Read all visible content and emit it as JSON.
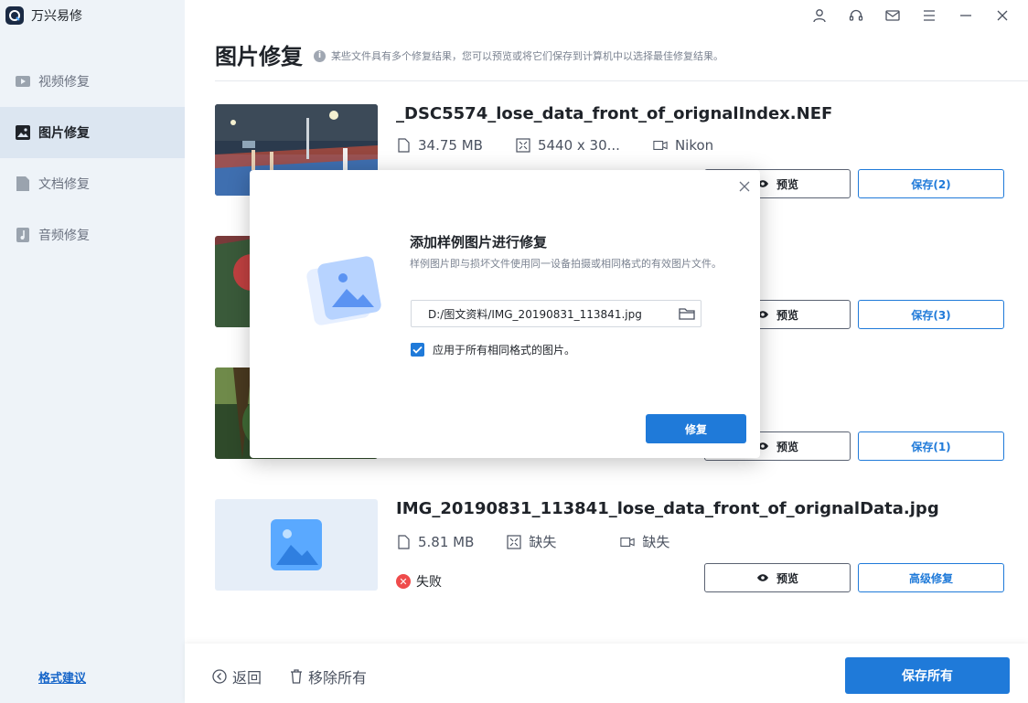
{
  "app": {
    "title": "万兴易修",
    "logo_icon": "app-logo-icon"
  },
  "titlebar": {
    "icons": [
      "user-icon",
      "headset-icon",
      "mail-icon",
      "menu-icon",
      "minimize-icon",
      "close-icon"
    ]
  },
  "sidebar": {
    "items": [
      {
        "label": "视频修复",
        "icon": "video-icon",
        "active": false
      },
      {
        "label": "图片修复",
        "icon": "image-icon",
        "active": true
      },
      {
        "label": "文档修复",
        "icon": "document-icon",
        "active": false
      },
      {
        "label": "音频修复",
        "icon": "music-icon",
        "active": false
      }
    ],
    "footer_link": "格式建议"
  },
  "main": {
    "title": "图片修复",
    "hint": "某些文件具有多个修复结果，您可以预览或将它们保存到计算机中以选择最佳修复结果。",
    "hint_icon": "info-icon",
    "items": [
      {
        "name": "_DSC5574_lose_data_front_of_orignalIndex.NEF",
        "size": "34.75  MB",
        "resolution": "5440 x 30...",
        "camera": "Nikon",
        "preview_label": "预览",
        "save_label": "保存(2)"
      },
      {
        "name": "",
        "preview_label": "预览",
        "save_label": "保存(3)"
      },
      {
        "name": "",
        "preview_label": "预览",
        "save_label": "保存(1)"
      },
      {
        "name": "IMG_20190831_113841_lose_data_front_of_orignalData.jpg",
        "size": "5.81  MB",
        "resolution": "缺失",
        "camera": "缺失",
        "status": "失败",
        "preview_label": "预览",
        "save_label": "高级修复"
      }
    ]
  },
  "bottom": {
    "back_label": "返回",
    "remove_label": "移除所有",
    "save_all_label": "保存所有"
  },
  "dialog": {
    "title": "添加样例图片进行修复",
    "description": "样例图片即与损坏文件使用同一设备拍摄或相同格式的有效图片文件。",
    "path_value": "D:/图文资料/IMG_20190831_113841.jpg",
    "checkbox_label": "应用于所有相同格式的图片。",
    "checkbox_checked": true,
    "repair_label": "修复"
  },
  "colors": {
    "accent": "#1f7ad9",
    "sidebar_bg": "#eef3f8",
    "sidebar_active": "#dce6f1",
    "fail": "#ef4b4b"
  }
}
